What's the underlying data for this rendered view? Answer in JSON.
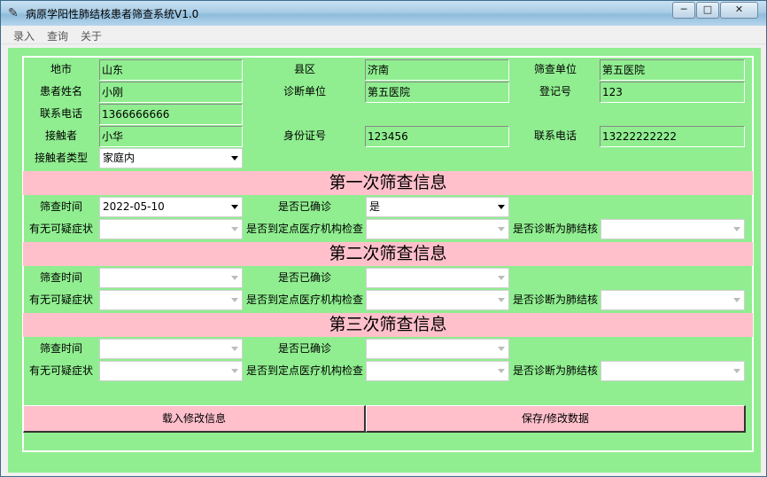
{
  "window": {
    "title": "病原学阳性肺结核患者筛查系统V1.0",
    "controls": {
      "minimize": "─",
      "maximize": "□",
      "close": "✕"
    }
  },
  "menu": {
    "items": [
      "录入",
      "查询",
      "关于"
    ]
  },
  "info": {
    "region_label": "地市",
    "region_value": "山东",
    "county_label": "县区",
    "county_value": "济南",
    "screen_unit_label": "筛查单位",
    "screen_unit_value": "第五医院",
    "patient_name_label": "患者姓名",
    "patient_name_value": "小刚",
    "diag_unit_label": "诊断单位",
    "diag_unit_value": "第五医院",
    "reg_no_label": "登记号",
    "reg_no_value": "123",
    "phone_label": "联系电话",
    "phone_value": "1366666666",
    "contact_label": "接触者",
    "contact_value": "小华",
    "id_label": "身份证号",
    "id_value": "123456",
    "contact_phone_label": "联系电话",
    "contact_phone_value": "13222222222",
    "contact_type_label": "接触者类型",
    "contact_type_value": "家庭内"
  },
  "screenings": [
    {
      "title": "第一次筛查信息",
      "time_label": "筛查时间",
      "time_value": "2022-05-10",
      "confirmed_label": "是否已确诊",
      "confirmed_value": "是",
      "symptom_label": "有无可疑症状",
      "symptom_value": "",
      "hospital_label": "是否到定点医疗机构检查",
      "hospital_value": "",
      "tb_label": "是否诊断为肺结核",
      "tb_value": ""
    },
    {
      "title": "第二次筛查信息",
      "time_label": "筛查时间",
      "time_value": "",
      "confirmed_label": "是否已确诊",
      "confirmed_value": "",
      "symptom_label": "有无可疑症状",
      "symptom_value": "",
      "hospital_label": "是否到定点医疗机构检查",
      "hospital_value": "",
      "tb_label": "是否诊断为肺结核",
      "tb_value": ""
    },
    {
      "title": "第三次筛查信息",
      "time_label": "筛查时间",
      "time_value": "",
      "confirmed_label": "是否已确诊",
      "confirmed_value": "",
      "symptom_label": "有无可疑症状",
      "symptom_value": "",
      "hospital_label": "是否到定点医疗机构检查",
      "hospital_value": "",
      "tb_label": "是否诊断为肺结核",
      "tb_value": ""
    }
  ],
  "buttons": {
    "load": "载入修改信息",
    "save": "保存/修改数据"
  },
  "colors": {
    "background": "#90ee90",
    "banner": "#ffc0cb",
    "button": "#ffc0cb"
  }
}
